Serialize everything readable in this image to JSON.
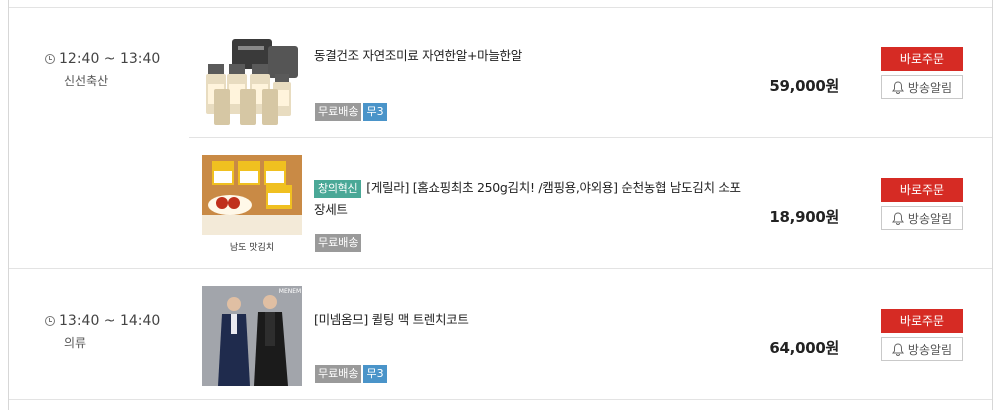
{
  "slots": [
    {
      "time": "12:40 ~ 13:40",
      "category": "신선축산",
      "items": [
        {
          "title": "동결건조 자연조미료 자연한알+마늘한알",
          "badge": "",
          "tags": [
            "무료배송",
            "무3"
          ],
          "price": "59,000원",
          "buy_label": "바로주문",
          "alarm_label": "방송알림"
        },
        {
          "title": "[게릴라] [홈쇼핑최초 250g김치! /캠핑용,야외용] 순천농협 남도김치 소포장세트",
          "badge": "창의혁신",
          "tags": [
            "무료배송"
          ],
          "price": "18,900원",
          "buy_label": "바로주문",
          "alarm_label": "방송알림",
          "image_text": "남도 맛김치"
        }
      ]
    },
    {
      "time": "13:40 ~ 14:40",
      "category": "의류",
      "items": [
        {
          "title": "[미넴옴므] 퀼팅 맥 트렌치코트",
          "badge": "",
          "tags": [
            "무료배송",
            "무3"
          ],
          "price": "64,000원",
          "buy_label": "바로주문",
          "alarm_label": "방송알림",
          "image_text": "MENEM"
        }
      ]
    }
  ],
  "colors": {
    "buy": "#d62b24",
    "badge": "#4aa897",
    "free_tag": "#9a9a9a",
    "m3_tag": "#4a94c9"
  }
}
